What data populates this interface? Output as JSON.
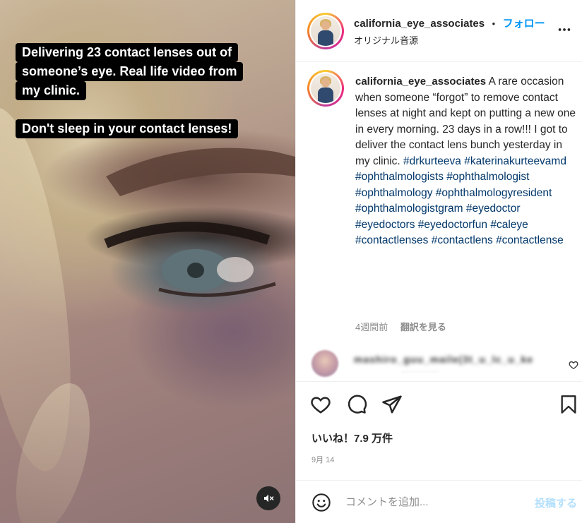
{
  "media": {
    "overlay_lines": [
      "Delivering 23 contact lenses out of",
      "someone’s eye. Real life video from",
      "my clinic.",
      "Don't sleep in your contact lenses!"
    ],
    "mute_icon": "speaker-muted-icon"
  },
  "header": {
    "username": "california_eye_associates",
    "separator": "•",
    "follow_label": "フォロー",
    "audio_label": "オリジナル音源",
    "more_icon": "more-horizontal-icon"
  },
  "caption": {
    "username": "california_eye_associates",
    "text": " A rare occasion when someone “forgot” to remove contact lenses at night and kept on putting a new one in every morning. 23 days in a row!!! I got to deliver the contact lens bunch yesterday in my clinic. ",
    "hashtags": [
      "#drkurteeva",
      "#katerinakurteevamd",
      "#ophthalmologists",
      "#ophthalmologist",
      "#ophthalmology",
      "#ophthalmologyresident",
      "#ophthalmologistgram",
      "#eyedoctor",
      "#eyedoctors",
      "#eyedoctorfun",
      "#caleye",
      "#contactlenses",
      "#contactlens",
      "#contactlense"
    ],
    "time_ago": "4週間前",
    "translate_label": "翻訳を見る"
  },
  "comment": {
    "blurred_text": "mashiro_guu_maile(3t_u_lc_u_ke",
    "blurred_sub": "·  · · · · · · · ·   ·  ·"
  },
  "actions": {
    "icons": [
      "heart-icon",
      "comment-icon",
      "share-icon",
      "bookmark-icon"
    ],
    "likes_label": "いいね！7.9 万件",
    "date": "9月 14"
  },
  "comment_box": {
    "placeholder": "コメントを追加...",
    "post_label": "投稿する"
  },
  "colors": {
    "link_blue": "#0095f6",
    "hashtag": "#00376b",
    "muted_text": "#8e8e8e",
    "post_disabled": "#b2dffc"
  }
}
